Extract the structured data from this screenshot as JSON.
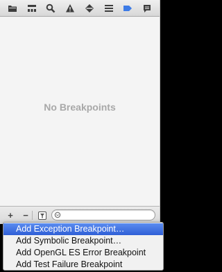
{
  "toolbar": {
    "icons": [
      {
        "name": "folder-icon"
      },
      {
        "name": "hierarchy-icon"
      },
      {
        "name": "search-icon"
      },
      {
        "name": "warning-icon"
      },
      {
        "name": "test-icon"
      },
      {
        "name": "debug-icon"
      },
      {
        "name": "breakpoint-icon",
        "selected": true,
        "color": "#3d7be6"
      },
      {
        "name": "log-icon"
      }
    ]
  },
  "main": {
    "empty_text": "No Breakpoints"
  },
  "bottom_bar": {
    "add_label": "+",
    "remove_label": "−",
    "search": {
      "value": "",
      "placeholder": ""
    }
  },
  "menu": {
    "items": [
      {
        "label": "Add Exception Breakpoint…",
        "selected": true
      },
      {
        "label": "Add Symbolic Breakpoint…",
        "selected": false
      },
      {
        "label": "Add OpenGL ES Error Breakpoint",
        "selected": false
      },
      {
        "label": "Add Test Failure Breakpoint",
        "selected": false
      }
    ],
    "selected_color": "#3b6fe0"
  }
}
